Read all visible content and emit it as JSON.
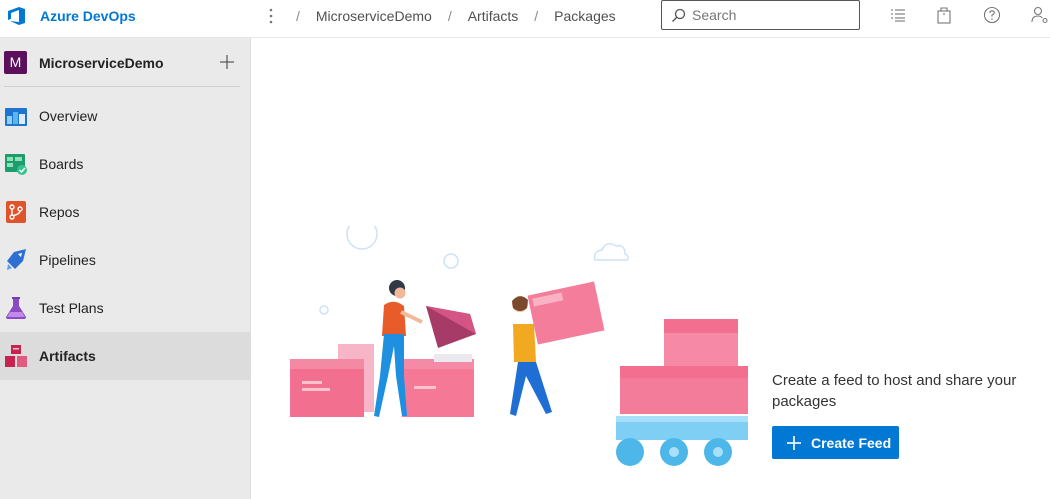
{
  "header": {
    "brand": "Azure DevOps",
    "breadcrumb": [
      "MicroserviceDemo",
      "Artifacts",
      "Packages"
    ],
    "search": {
      "placeholder": "Search",
      "value": ""
    },
    "icons": [
      "task-list-icon",
      "marketplace-bag-icon",
      "help-icon",
      "user-settings-icon"
    ]
  },
  "sidebar": {
    "project": {
      "initial": "M",
      "name": "MicroserviceDemo",
      "avatar_color": "#5c0f5b"
    },
    "items": [
      {
        "label": "Overview",
        "icon": "overview-icon",
        "active": false
      },
      {
        "label": "Boards",
        "icon": "boards-icon",
        "active": false
      },
      {
        "label": "Repos",
        "icon": "repos-icon",
        "active": false
      },
      {
        "label": "Pipelines",
        "icon": "pipelines-icon",
        "active": false
      },
      {
        "label": "Test Plans",
        "icon": "test-plans-icon",
        "active": false
      },
      {
        "label": "Artifacts",
        "icon": "artifacts-icon",
        "active": true
      }
    ]
  },
  "main": {
    "empty_state": {
      "message": "Create a feed to host and share your packages",
      "button_label": "Create Feed"
    }
  },
  "colors": {
    "accent": "#0078d4",
    "sidebar_bg": "#eaeaea",
    "active_item_bg": "#dcdcdc"
  }
}
